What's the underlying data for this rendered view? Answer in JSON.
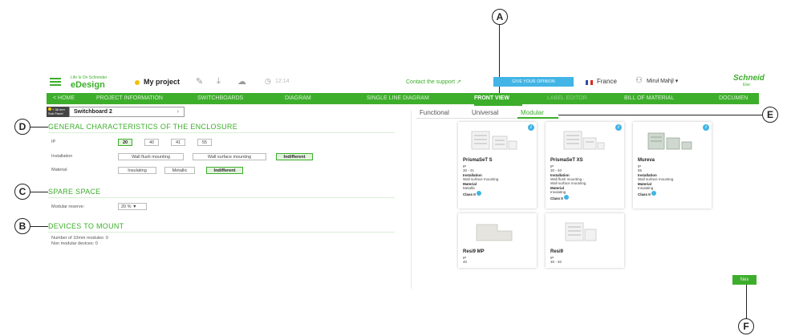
{
  "header": {
    "logo_small": "Life Is On Schneider",
    "logo_main": "eDesign",
    "project_name": "My project",
    "timer": "12:14",
    "support_text": "Contact the support",
    "opinion_button": "GIVE YOUR OPINION",
    "country": "France",
    "user": "Miruł Mahjl",
    "brand": "Schneid",
    "brand_sub": "Elec",
    "icons": [
      "hamburger-icon",
      "pencil-icon",
      "download-icon",
      "cloud-icon",
      "clock-icon",
      "external-link-icon",
      "user-icon",
      "chevron-down-icon"
    ]
  },
  "nav": {
    "items": [
      "< HOME",
      "PROJECT INFORMATION",
      "SWITCHBOARDS",
      "DIAGRAM",
      "SINGLE LINE DIAGRAM",
      "FRONT VIEW",
      "LABEL EDITOR",
      "BILL OF MATERIAL",
      "DOCUMEN"
    ],
    "active": "FRONT VIEW"
  },
  "left": {
    "sub_panel": "+ 38 mm Sub Panel",
    "switchboard_select": "Switchboard 2",
    "section_general": "GENERAL CHARACTERISTICS OF THE ENCLOSURE",
    "ip_label": "IP",
    "ip_options": [
      "20",
      "40",
      "41",
      "55"
    ],
    "ip_selected": "20",
    "installation_label": "Installation",
    "installation_options": [
      "Wall flush mounting",
      "Wall surface mounting",
      "Indifferent"
    ],
    "installation_selected": "Indifferent",
    "material_label": "Material",
    "material_options": [
      "Insulating",
      "Metallic",
      "Indifferent"
    ],
    "material_selected": "Indifferent",
    "section_spare": "SPARE SPACE",
    "modular_reserve_label": "Modular reserve:",
    "modular_reserve_value": "20 % ▼",
    "section_devices": "DEVICES TO MOUNT",
    "devices_line1": "Number of 10mm modules:  0",
    "devices_line2": "Non modular devices:  0"
  },
  "right": {
    "tabs": [
      "Functional",
      "Universal",
      "Modular"
    ],
    "active_tab": "Modular",
    "cards": [
      {
        "name": "PrismaSeT S",
        "ip_label": "IP",
        "ip": "30 - 41",
        "inst_label": "Installation",
        "inst": "Wall surface mounting",
        "inst2": "",
        "mat_label": "Material",
        "mat": "Metallic",
        "class": "Class II"
      },
      {
        "name": "PrismaSeT XS",
        "ip_label": "IP",
        "ip": "30 - 40",
        "inst_label": "Installation",
        "inst": "Wall flush mounting -",
        "inst2": "Wall surface mounting",
        "mat_label": "Material",
        "mat": "Insulating",
        "class": "Class II"
      },
      {
        "name": "Mureva",
        "ip_label": "IP",
        "ip": "65",
        "inst_label": "Installation",
        "inst": "Wall surface mounting",
        "inst2": "",
        "mat_label": "Material",
        "mat": "Insulating",
        "class": "Class II"
      },
      {
        "name": "Resi9 MP",
        "ip_label": "IP",
        "ip": "40",
        "inst_label": "",
        "inst": "",
        "inst2": "",
        "mat_label": "",
        "mat": "",
        "class": ""
      },
      {
        "name": "Resi9",
        "ip_label": "IP",
        "ip": "30 - 40",
        "inst_label": "",
        "inst": "",
        "inst2": "",
        "mat_label": "",
        "mat": "",
        "class": ""
      }
    ],
    "next_button": "Nex"
  },
  "callouts": [
    "A",
    "B",
    "C",
    "D",
    "E",
    "F"
  ],
  "colors": {
    "brand_green": "#3dae2b",
    "info_blue": "#42b4e6",
    "project_dot": "#f2c200"
  }
}
